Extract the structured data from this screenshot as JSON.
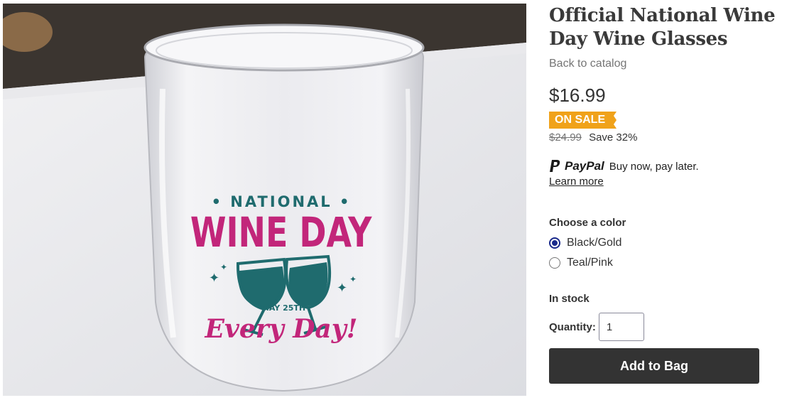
{
  "product": {
    "title": "Official National Wine Day Wine Glasses",
    "back_link": "Back to catalog",
    "price": "$16.99",
    "sale_badge": "ON SALE",
    "original_price": "$24.99",
    "savings": "Save 32%"
  },
  "image": {
    "print_national": "• NATIONAL •",
    "print_wine_day": "WINE DAY",
    "print_date": "MAY 25TH",
    "print_every_day": "Every Day!",
    "colors": {
      "magenta": "#c2267a",
      "teal": "#1f6b6e"
    }
  },
  "paypal": {
    "brand": "PayPal",
    "tagline": "Buy now, pay later.",
    "learn_more": "Learn more"
  },
  "color_selector": {
    "label": "Choose a color",
    "options": [
      {
        "label": "Black/Gold",
        "selected": true
      },
      {
        "label": "Teal/Pink",
        "selected": false
      }
    ]
  },
  "stock_status": "In stock",
  "quantity": {
    "label": "Quantity:",
    "value": "1"
  },
  "add_to_bag": "Add to Bag",
  "theme": {
    "badge_color": "#f0a21a",
    "button_color": "#333333",
    "radio_color": "#1a2a8c"
  }
}
